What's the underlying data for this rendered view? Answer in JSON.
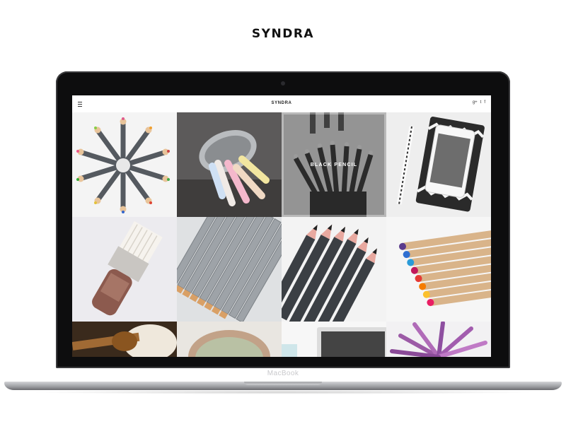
{
  "brand": {
    "title": "SYNDRA"
  },
  "device": {
    "label": "MacBook"
  },
  "site": {
    "logo": "SYNDRA",
    "social": [
      "g+",
      "t",
      "f"
    ]
  },
  "gallery": {
    "hover_label": "BLACK PENCIL",
    "tiles": [
      "colored-pencils-circle",
      "chalk-bucket",
      "black-pencil",
      "tablet-pen",
      "paint-brush",
      "gray-pencils",
      "black-pencils-pink-tips",
      "colored-pencils-row",
      "honey-dipper",
      "cactus",
      "laptop-cup",
      "purple-plant"
    ]
  },
  "colors": {
    "lid": "#0d0d0e",
    "base": "#9b9ca0",
    "screen_bg": "#ffffff"
  }
}
